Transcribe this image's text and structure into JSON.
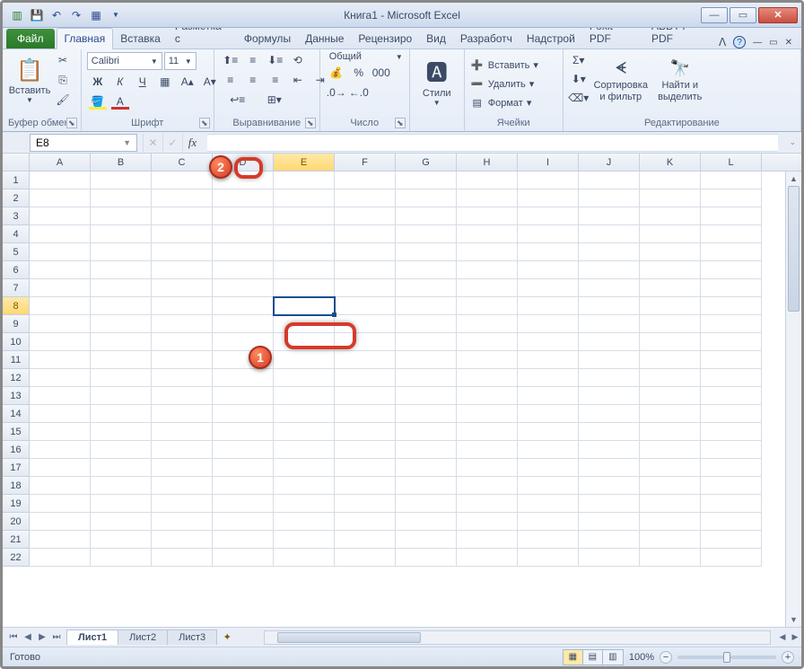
{
  "title": "Книга1 - Microsoft Excel",
  "qat": {
    "save": "💾",
    "undo": "↶",
    "redo": "↷",
    "new": "▦"
  },
  "win": {
    "min": "—",
    "max": "▭",
    "close": "✕"
  },
  "tabs": {
    "file": "Файл",
    "items": [
      "Главная",
      "Вставка",
      "Разметка с",
      "Формулы",
      "Данные",
      "Рецензиро",
      "Вид",
      "Разработч",
      "Надстрой",
      "Foxit PDF",
      "ABBYY PDF"
    ],
    "active": 0
  },
  "ribbon": {
    "clipboard": {
      "label": "Буфер обмена",
      "paste": "Вставить"
    },
    "font": {
      "label": "Шрифт",
      "name": "Calibri",
      "size": "11"
    },
    "alignment": {
      "label": "Выравнивание"
    },
    "number": {
      "label": "Число",
      "format": "Общий"
    },
    "styles": {
      "label": "Стили",
      "btn": "Стили"
    },
    "cells": {
      "label": "Ячейки",
      "insert": "Вставить",
      "delete": "Удалить",
      "format": "Формат"
    },
    "editing": {
      "label": "Редактирование",
      "sort": "Сортировка и фильтр",
      "find": "Найти и выделить"
    }
  },
  "formula_bar": {
    "namebox": "E8",
    "fx": "fx"
  },
  "grid": {
    "cols": [
      "A",
      "B",
      "C",
      "D",
      "E",
      "F",
      "G",
      "H",
      "I",
      "J",
      "K",
      "L"
    ],
    "rows": 22,
    "sel_col": "E",
    "sel_row": 8,
    "active_cell": "E8"
  },
  "sheets": {
    "items": [
      "Лист1",
      "Лист2",
      "Лист3"
    ],
    "active": 0
  },
  "status": {
    "ready": "Готово",
    "zoom": "100%"
  },
  "callouts": {
    "1": "1",
    "2": "2"
  }
}
